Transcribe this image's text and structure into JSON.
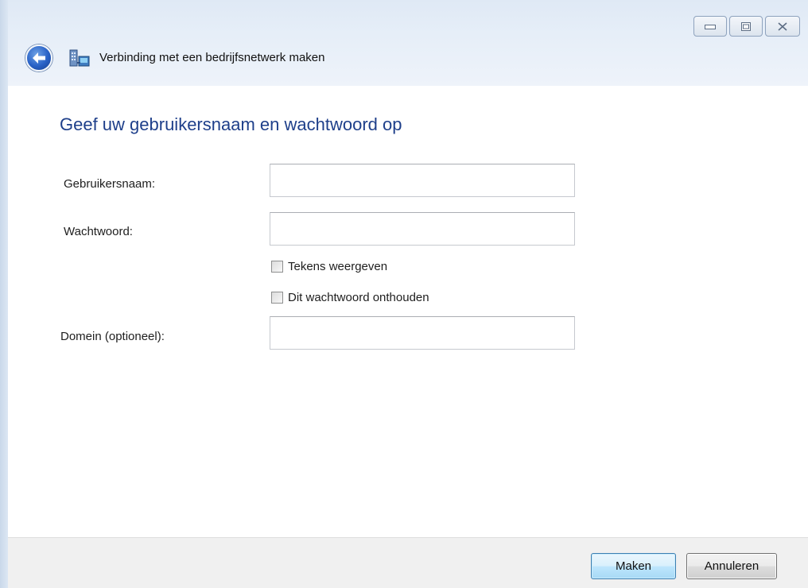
{
  "window": {
    "title": "Verbinding met een bedrijfsnetwerk maken",
    "icon": "network-connection-icon",
    "caption_buttons": [
      "minimize-icon",
      "maximize-icon",
      "close-icon"
    ]
  },
  "page": {
    "heading": "Geef uw gebruikersnaam en wachtwoord op"
  },
  "form": {
    "username_label": "Gebruikersnaam:",
    "username_value": "",
    "password_label": "Wachtwoord:",
    "password_value": "",
    "show_chars_label": "Tekens weergeven",
    "show_chars_checked": false,
    "remember_label": "Dit wachtwoord onthouden",
    "remember_checked": false,
    "domain_label": "Domein (optioneel):",
    "domain_value": ""
  },
  "footer": {
    "primary_label": "Maken",
    "cancel_label": "Annuleren"
  },
  "colors": {
    "heading": "#1e3f8a",
    "header_bg": "#e6eef8",
    "footer_bg": "#f0f0f0",
    "primary_border": "#3c7fb1"
  }
}
